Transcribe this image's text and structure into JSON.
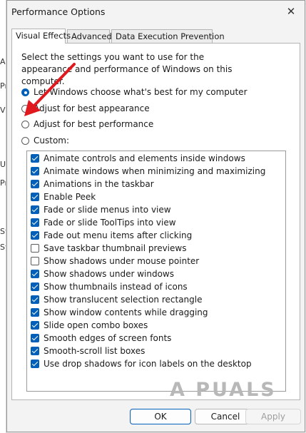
{
  "background_fragments": [
    "Ap",
    "Pr",
    "Vi",
    "Us",
    "Pr",
    "St",
    "Sy"
  ],
  "window": {
    "title": "Performance Options",
    "close_glyph": "✕"
  },
  "tabs": [
    {
      "label": "Visual Effects"
    },
    {
      "label": "Advanced"
    },
    {
      "label": "Data Execution Prevention"
    }
  ],
  "visual_effects": {
    "description": "Select the settings you want to use for the appearance and performance of Windows on this computer.",
    "options": [
      {
        "label": "Let Windows choose what's best for my computer",
        "checked": true,
        "access_key": "L"
      },
      {
        "label": "Adjust for best appearance",
        "checked": false,
        "access_key": "b"
      },
      {
        "label": "Adjust for best performance",
        "checked": false,
        "access_key": "p"
      },
      {
        "label": "Custom:",
        "checked": false,
        "access_key": "C"
      }
    ],
    "effects": [
      {
        "label": "Animate controls and elements inside windows",
        "checked": true
      },
      {
        "label": "Animate windows when minimizing and maximizing",
        "checked": true
      },
      {
        "label": "Animations in the taskbar",
        "checked": true
      },
      {
        "label": "Enable Peek",
        "checked": true
      },
      {
        "label": "Fade or slide menus into view",
        "checked": true
      },
      {
        "label": "Fade or slide ToolTips into view",
        "checked": true
      },
      {
        "label": "Fade out menu items after clicking",
        "checked": true
      },
      {
        "label": "Save taskbar thumbnail previews",
        "checked": false
      },
      {
        "label": "Show shadows under mouse pointer",
        "checked": false
      },
      {
        "label": "Show shadows under windows",
        "checked": true
      },
      {
        "label": "Show thumbnails instead of icons",
        "checked": true
      },
      {
        "label": "Show translucent selection rectangle",
        "checked": true
      },
      {
        "label": "Show window contents while dragging",
        "checked": true
      },
      {
        "label": "Slide open combo boxes",
        "checked": true
      },
      {
        "label": "Smooth edges of screen fonts",
        "checked": true
      },
      {
        "label": "Smooth-scroll list boxes",
        "checked": true
      },
      {
        "label": "Use drop shadows for icon labels on the desktop",
        "checked": true
      }
    ]
  },
  "watermark": "A  PUALS",
  "buttons": {
    "ok": "OK",
    "cancel": "Cancel",
    "apply": "Apply"
  },
  "colors": {
    "accent": "#005fb8",
    "annotation_arrow": "#e0191f"
  },
  "icons": {
    "annotation": "red-arrow-icon"
  }
}
